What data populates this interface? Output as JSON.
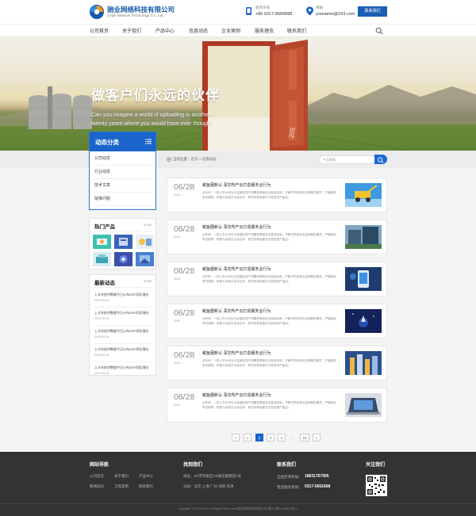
{
  "header": {
    "brand_cn": "驰业网络科技有限公司",
    "brand_en": "Chiye Network Technology Co., Ltd.",
    "phone_label": "服务热线",
    "phone": "+86 0317-8566888",
    "email_label": "邮箱",
    "email": "youname@163.com",
    "contact_button": "联系我们"
  },
  "nav": {
    "items": [
      "公司首页",
      "关于我们",
      "产品中心",
      "信息动态",
      "企业案例",
      "服务理念",
      "联系我们"
    ]
  },
  "banner": {
    "slogan": "做客户们永远的伙伴",
    "slogan_en_1": "Can you imagine a world of uploading in another",
    "slogan_en_2": "twenty years where you would have ever thought",
    "door_number": "205"
  },
  "breadcrumb": {
    "text": "当前位置：首页 > 信息动态",
    "search_placeholder": "产品搜索"
  },
  "category": {
    "title": "动态分类",
    "items": [
      "公司动态",
      "行业动态",
      "技术文章",
      "疑难问题"
    ]
  },
  "hot": {
    "title": "热门产品",
    "more": "MORE"
  },
  "latest": {
    "title": "最新动态",
    "more": "MORE",
    "items": [
      {
        "title": "上半年经济数据今日公布GDP同比增长",
        "date": "2019-05-16"
      },
      {
        "title": "上半年经济数据今日公布GDP同比增长",
        "date": "2019-05-16"
      },
      {
        "title": "上半年经济数据今日公布GDP同比增长",
        "date": "2019-05-16"
      },
      {
        "title": "上半年经济数据今日公布GDP同比增长",
        "date": "2019-05-16"
      },
      {
        "title": "上半年经济数据今日公布GDP同比增长",
        "date": "2019-05-16"
      }
    ]
  },
  "articles": [
    {
      "day": "06/28",
      "year": "2018",
      "title": "鲅鱼圈新认 深交所产云打造服务业行为",
      "desc": "近年来，一批上市公司为沉淀固定资产闲置资源而设法盘活利用，不断开拓多种业态和服务模式，严格落实有关政策，积极与对接方洽谈合作，研究多种经营方式促进资产盘活。"
    },
    {
      "day": "06/28",
      "year": "2018",
      "title": "鲅鱼圈新认 深交所产云打造服务业行为",
      "desc": "近年来，一批上市公司为沉淀固定资产闲置资源而设法盘活利用，不断开拓多种业态和服务模式，严格落实有关政策，积极与对接方洽谈合作，研究多种经营方式促进资产盘活。"
    },
    {
      "day": "06/28",
      "year": "2018",
      "title": "鲅鱼圈新认 深交所产云打造服务业行为",
      "desc": "近年来，一批上市公司为沉淀固定资产闲置资源而设法盘活利用，不断开拓多种业态和服务模式，严格落实有关政策，积极与对接方洽谈合作，研究多种经营方式促进资产盘活。"
    },
    {
      "day": "06/28",
      "year": "2018",
      "title": "鲅鱼圈新认 深交所产云打造服务业行为",
      "desc": "近年来，一批上市公司为沉淀固定资产闲置资源而设法盘活利用，不断开拓多种业态和服务模式，严格落实有关政策，积极与对接方洽谈合作，研究多种经营方式促进资产盘活。"
    },
    {
      "day": "06/28",
      "year": "2018",
      "title": "鲅鱼圈新认 深交所产云打造服务业行为",
      "desc": "近年来，一批上市公司为沉淀固定资产闲置资源而设法盘活利用，不断开拓多种业态和服务模式，严格落实有关政策，积极与对接方洽谈合作，研究多种经营方式促进资产盘活。"
    },
    {
      "day": "06/28",
      "year": "2018",
      "title": "鲅鱼圈新认 深交所产云打造服务业行为",
      "desc": "近年来，一批上市公司为沉淀固定资产闲置资源而设法盘活利用，不断开拓多种业态和服务模式，严格落实有关政策，积极与对接方洽谈合作，研究多种经营方式促进资产盘活。"
    }
  ],
  "pagination": [
    "<",
    "1",
    "2",
    "3",
    "4",
    "...",
    "15",
    ">"
  ],
  "footer": {
    "nav_title": "网站导航",
    "nav_links": [
      "公司首页",
      "关于我们",
      "产品中心",
      "新闻动态",
      "工程案例",
      "联系我们"
    ],
    "find_title": "找到我们",
    "address": "地址：XX市开发区XX城东路南首1号",
    "branches": "分站：北京  上海  广州  深圳  天津",
    "contact_title": "联系我们",
    "hotline_label": "全国咨询热线：",
    "hotline": "18831767995",
    "service_label": "售后服务热线：",
    "service_phone": "0317-5661668",
    "follow_title": "关注我们",
    "copyright": "Copyright © 2019-2020  All Rights Reserved  驰业网络科技有限公司    冀ICP备12345678号-1"
  },
  "colors": {
    "brand_blue": "#1a64cc",
    "footer_bg": "#333333"
  }
}
